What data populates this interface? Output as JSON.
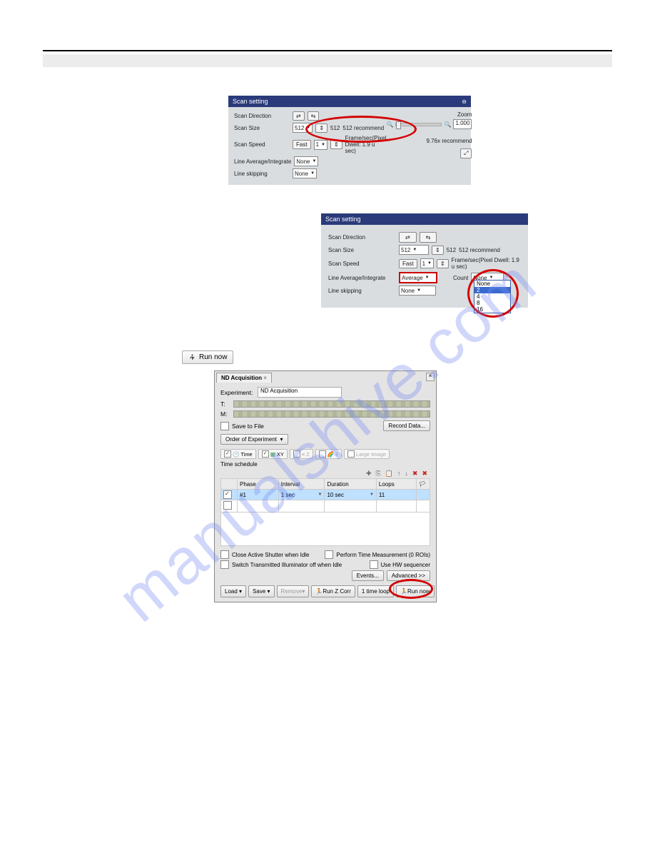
{
  "watermark": "manualshive.com",
  "panel1": {
    "title": "Scan setting",
    "scan_direction_label": "Scan Direction",
    "scan_size_label": "Scan Size",
    "scan_size_value": "512",
    "scan_size_hint": "512",
    "scan_size_rec": "512 recommend",
    "scan_speed_label": "Scan Speed",
    "scan_speed_btn": "Fast",
    "scan_speed_value": "1",
    "frame_hint": "Frame/sec(Pixel Dwell: 1.9 u sec)",
    "line_avg_label": "Line Average/Integrate",
    "line_avg_value": "None",
    "line_skip_label": "Line skipping",
    "line_skip_value": "None",
    "zoom_label": "Zoom",
    "zoom_value": "1.000",
    "rec": "9.76x recommend"
  },
  "panel2": {
    "title": "Scan setting",
    "scan_direction_label": "Scan Direction",
    "scan_size_label": "Scan Size",
    "scan_size_value": "512",
    "scan_size_hint": "512",
    "scan_size_rec": "512 recommend",
    "scan_speed_label": "Scan Speed",
    "scan_speed_btn": "Fast",
    "scan_speed_value": "1",
    "frame_hint": "Frame/sec(Pixel Dwell: 1.9 u sec)",
    "line_avg_label": "Line Average/Integrate",
    "line_avg_value": "Average",
    "count_label": "Count",
    "count_value": "None",
    "line_skip_label": "Line skipping",
    "line_skip_value": "None",
    "dropdown": [
      "None",
      "2",
      "4",
      "8",
      "16"
    ],
    "dropdown_selected": "2"
  },
  "runnow_small": "Run now",
  "nd": {
    "tab": "ND Acquisition",
    "close": "×",
    "experiment_label": "Experiment:",
    "experiment_value": "ND Acquisition",
    "t_label": "T:",
    "m_label": "M:",
    "save_to_file": "Save to File",
    "record_data": "Record Data...",
    "order_label": "Order of Experiment",
    "tabs": {
      "time": "Time",
      "xy": "XY",
      "z": "Z",
      "lambda": "λ",
      "large": "Large Image"
    },
    "sched_title": "Time schedule",
    "columns": {
      "phase": "Phase",
      "interval": "Interval",
      "duration": "Duration",
      "loops": "Loops"
    },
    "row": {
      "phase": "#1",
      "interval": "1 sec",
      "duration": "10 sec",
      "loops": "11"
    },
    "opt1": "Close Active Shutter when Idle",
    "opt2": "Perform Time Measurement (0 ROIs)",
    "opt3": "Switch Transmitted Illuminator off when Idle",
    "opt4": "Use HW sequencer",
    "events_btn": "Events...",
    "advanced_btn": "Advanced >>",
    "buttons": {
      "load": "Load ▾",
      "save": "Save ▾",
      "remove": "Remove▾",
      "runz": "Run Z Corr",
      "onetime": "1 time loop",
      "runnow": "Run now"
    }
  }
}
